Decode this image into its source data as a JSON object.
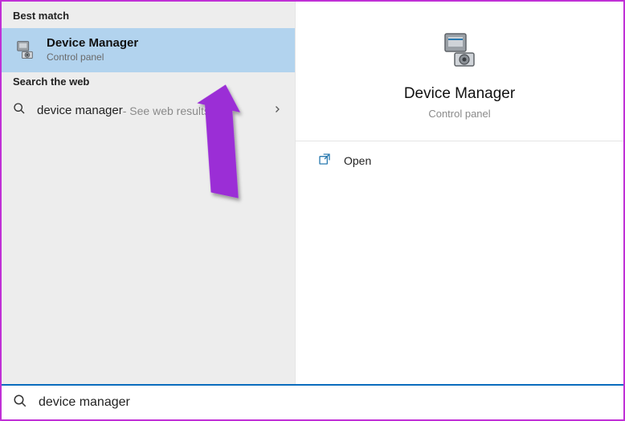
{
  "left": {
    "section_best_match": "Best match",
    "best_match": {
      "title": "Device Manager",
      "subtitle": "Control panel"
    },
    "section_web": "Search the web",
    "web_result": {
      "query": "device manager",
      "hint": " - See web results"
    }
  },
  "right": {
    "title": "Device Manager",
    "subtitle": "Control panel",
    "action_open": "Open"
  },
  "search": {
    "value": "device manager"
  }
}
